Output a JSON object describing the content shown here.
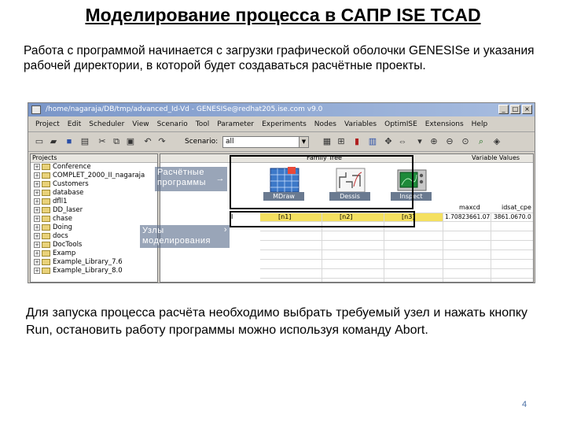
{
  "slide": {
    "title": "Моделирование процесса в САПР ISE TCAD",
    "intro": "Работа с программой начинается с загрузки графической оболочки GENESISe и указания рабочей директории, в которой будет создаваться расчётные проекты.",
    "bottom_text": "Для запуска процесса расчёта необходимо выбрать требуемый узел и нажать кнопку Run, остановить работу программы можно используя команду Abort.",
    "page_number": "4"
  },
  "window": {
    "title": "/home/nagaraja/DB/tmp/advanced_Id-Vd - GENESISe@redhat205.ise.com v9.0",
    "menu": [
      "Project",
      "Edit",
      "Scheduler",
      "View",
      "Scenario",
      "Tool",
      "Parameter",
      "Experiments",
      "Nodes",
      "Variables",
      "OptimISE",
      "Extensions",
      "Help"
    ],
    "toolbar": {
      "scenario_label": "Scenario:",
      "scenario_value": "all"
    },
    "tree": {
      "header": "Projects",
      "items": [
        "Conference",
        "COMPLET_2000_II_nagaraja",
        "Customers",
        "database",
        "dfll1",
        "DD_laser",
        "chase",
        "Doing",
        "docs",
        "DocTools",
        "Examp",
        "Example_Library_7.6",
        "Example_Library_8.0"
      ]
    },
    "family_tree": {
      "header": "Family Tree",
      "variables_header": "Variable Values",
      "tools": [
        "MDraw",
        "Dessis",
        "Inspect"
      ],
      "left_col": "I",
      "col_headers": [
        "maxcd",
        "idsat_cpe"
      ],
      "nodes": [
        "[n1]",
        "[n2]",
        "[n3]"
      ],
      "values": [
        "1.70823661.07",
        "3861.0670.0"
      ]
    }
  },
  "callouts": {
    "solvers": "Расчётные программы",
    "solvers_arrow": "→",
    "nodes": "Узлы моделирования",
    "nodes_arrow": "›"
  }
}
